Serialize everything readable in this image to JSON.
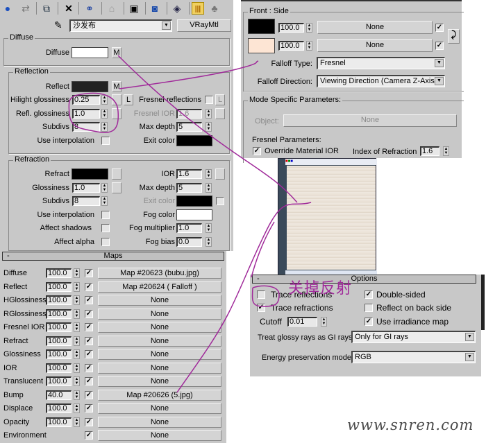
{
  "toolbar": {
    "icons": [
      "get-material-icon",
      "put-to-scene-icon",
      "assign-material-icon",
      "reset-icon",
      "make-copy-icon",
      "make-unique-icon",
      "put-to-library-icon",
      "material-effects-channel-icon",
      "show-map-icon",
      "show-end-result-icon",
      "go-to-parent-icon"
    ]
  },
  "material": {
    "name": "沙发布",
    "type": "VRayMtl"
  },
  "diffuse": {
    "group": "Diffuse",
    "label": "Diffuse",
    "map_btn": "M",
    "color": "#ffffff"
  },
  "reflection": {
    "group": "Reflection",
    "reflect": "Reflect",
    "reflect_color": "#222222",
    "map_btn": "M",
    "hilight_label": "Hilight glossiness",
    "hilight": "0.25",
    "lock": "L",
    "refl_gloss_label": "Refl. glossiness",
    "refl_gloss": "1.0",
    "subdivs_label": "Subdivs",
    "subdivs": "8",
    "use_interp": "Use interpolation",
    "fresnel_label": "Fresnel reflections",
    "fresnel_lock": "L",
    "fresnel_ior_label": "Fresnel IOR",
    "fresnel_ior": "1.6",
    "max_depth_label": "Max depth",
    "max_depth": "5",
    "exit_color_label": "Exit color"
  },
  "refraction": {
    "group": "Refraction",
    "refract": "Refract",
    "gloss_label": "Glossiness",
    "gloss": "1.0",
    "subdivs_label": "Subdivs",
    "subdivs": "8",
    "use_interp": "Use interpolation",
    "affect_shadows": "Affect shadows",
    "affect_alpha": "Affect alpha",
    "ior_label": "IOR",
    "ior": "1.6",
    "max_depth_label": "Max depth",
    "max_depth": "5",
    "exit_color_label": "Exit color",
    "fog_color_label": "Fog color",
    "fog_mult_label": "Fog multiplier",
    "fog_mult": "1.0",
    "fog_bias_label": "Fog bias",
    "fog_bias": "0.0"
  },
  "maps": {
    "title": "Maps",
    "collapse": "-",
    "rows": [
      {
        "label": "Diffuse",
        "amount": "100.0",
        "checked": true,
        "map": "Map #20623 (bubu.jpg)"
      },
      {
        "label": "Reflect",
        "amount": "100.0",
        "checked": true,
        "map": "Map #20624  ( Falloff )"
      },
      {
        "label": "HGlossiness",
        "amount": "100.0",
        "checked": true,
        "map": "None"
      },
      {
        "label": "RGlossiness",
        "amount": "100.0",
        "checked": true,
        "map": "None"
      },
      {
        "label": "Fresnel IOR",
        "amount": "100.0",
        "checked": true,
        "map": "None"
      },
      {
        "label": "Refract",
        "amount": "100.0",
        "checked": true,
        "map": "None"
      },
      {
        "label": "Glossiness",
        "amount": "100.0",
        "checked": true,
        "map": "None"
      },
      {
        "label": "IOR",
        "amount": "100.0",
        "checked": true,
        "map": "None"
      },
      {
        "label": "Translucent",
        "amount": "100.0",
        "checked": true,
        "map": "None"
      },
      {
        "label": "Bump",
        "amount": "40.0",
        "checked": true,
        "map": "Map #20626 (5.jpg)"
      },
      {
        "label": "Displace",
        "amount": "100.0",
        "checked": true,
        "map": "None"
      },
      {
        "label": "Opacity",
        "amount": "100.0",
        "checked": true,
        "map": "None"
      },
      {
        "label": "Environment",
        "amount": null,
        "checked": true,
        "map": "None"
      }
    ]
  },
  "falloff": {
    "group": "Front : Side",
    "front_amount": "100.0",
    "front_map": "None",
    "front_color": "#000000",
    "side_amount": "100.0",
    "side_map": "None",
    "side_color": "#fde5d4",
    "type_label": "Falloff Type:",
    "type": "Fresnel",
    "dir_label": "Falloff Direction:",
    "dir": "Viewing Direction (Camera Z-Axis)",
    "mode_group": "Mode Specific Parameters:",
    "object_label": "Object:",
    "object": "None",
    "fresnel_params": "Fresnel Parameters:",
    "override_ior": "Override Material IOR",
    "ior_label": "Index of Refraction",
    "ior": "1.6"
  },
  "options": {
    "title": "Options",
    "collapse": "-",
    "trace_reflections": "Trace reflections",
    "trace_refractions": "Trace refractions",
    "cutoff_label": "Cutoff",
    "cutoff": "0.01",
    "double_sided": "Double-sided",
    "reflect_back": "Reflect on back side",
    "use_irradiance": "Use irradiance map",
    "glossy_label": "Treat glossy rays as GI rays:",
    "glossy": "Only for GI rays",
    "energy_label": "Energy preservation mode:",
    "energy": "RGB"
  },
  "annotation": {
    "text": "关掉反射",
    "color": "#a02a9a"
  },
  "watermark": "www.snren.com"
}
